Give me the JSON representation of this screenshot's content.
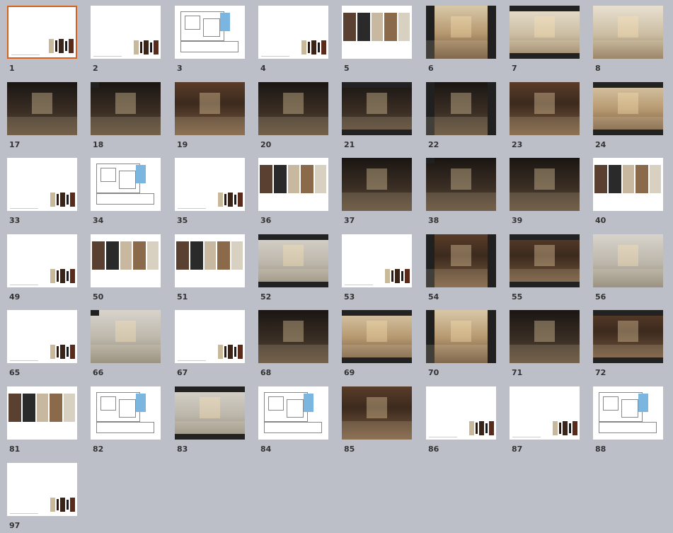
{
  "pages": [
    {
      "n": "1",
      "kind": "blank",
      "selected": true
    },
    {
      "n": "2",
      "kind": "blank"
    },
    {
      "n": "3",
      "kind": "plan"
    },
    {
      "n": "4",
      "kind": "blank"
    },
    {
      "n": "5",
      "kind": "mood"
    },
    {
      "n": "6",
      "kind": "render",
      "style": "warm"
    },
    {
      "n": "7",
      "kind": "render",
      "style": "light"
    },
    {
      "n": "8",
      "kind": "render",
      "style": "light"
    },
    {
      "n": "17",
      "kind": "render",
      "style": "dark"
    },
    {
      "n": "18",
      "kind": "render",
      "style": "dark"
    },
    {
      "n": "19",
      "kind": "render",
      "style": "wood"
    },
    {
      "n": "20",
      "kind": "render",
      "style": "dark"
    },
    {
      "n": "21",
      "kind": "render",
      "style": "dark"
    },
    {
      "n": "22",
      "kind": "render",
      "style": "dark"
    },
    {
      "n": "23",
      "kind": "render",
      "style": "wood"
    },
    {
      "n": "24",
      "kind": "render",
      "style": "warm"
    },
    {
      "n": "33",
      "kind": "blank"
    },
    {
      "n": "34",
      "kind": "plan"
    },
    {
      "n": "35",
      "kind": "blank"
    },
    {
      "n": "36",
      "kind": "mood"
    },
    {
      "n": "37",
      "kind": "render",
      "style": "dark"
    },
    {
      "n": "38",
      "kind": "render",
      "style": "dark"
    },
    {
      "n": "39",
      "kind": "render",
      "style": "dark"
    },
    {
      "n": "40",
      "kind": "mood"
    },
    {
      "n": "49",
      "kind": "blank"
    },
    {
      "n": "50",
      "kind": "mood"
    },
    {
      "n": "51",
      "kind": "mood"
    },
    {
      "n": "52",
      "kind": "render",
      "style": "grey"
    },
    {
      "n": "53",
      "kind": "blank"
    },
    {
      "n": "54",
      "kind": "render",
      "style": "wood"
    },
    {
      "n": "55",
      "kind": "render",
      "style": "wood"
    },
    {
      "n": "56",
      "kind": "render",
      "style": "grey"
    },
    {
      "n": "65",
      "kind": "blank"
    },
    {
      "n": "66",
      "kind": "render",
      "style": "grey"
    },
    {
      "n": "67",
      "kind": "blank"
    },
    {
      "n": "68",
      "kind": "render",
      "style": "dark"
    },
    {
      "n": "69",
      "kind": "render",
      "style": "warm"
    },
    {
      "n": "70",
      "kind": "render",
      "style": "warm"
    },
    {
      "n": "71",
      "kind": "render",
      "style": "dark"
    },
    {
      "n": "72",
      "kind": "render",
      "style": "wood"
    },
    {
      "n": "81",
      "kind": "mood"
    },
    {
      "n": "82",
      "kind": "plan"
    },
    {
      "n": "83",
      "kind": "render",
      "style": "grey"
    },
    {
      "n": "84",
      "kind": "plan"
    },
    {
      "n": "85",
      "kind": "render",
      "style": "wood"
    },
    {
      "n": "86",
      "kind": "blank"
    },
    {
      "n": "87",
      "kind": "blank"
    },
    {
      "n": "88",
      "kind": "plan"
    },
    {
      "n": "97",
      "kind": "blank"
    }
  ],
  "colors": {
    "background": "#bcbec8",
    "selection": "#d2621f",
    "label": "#333333"
  }
}
